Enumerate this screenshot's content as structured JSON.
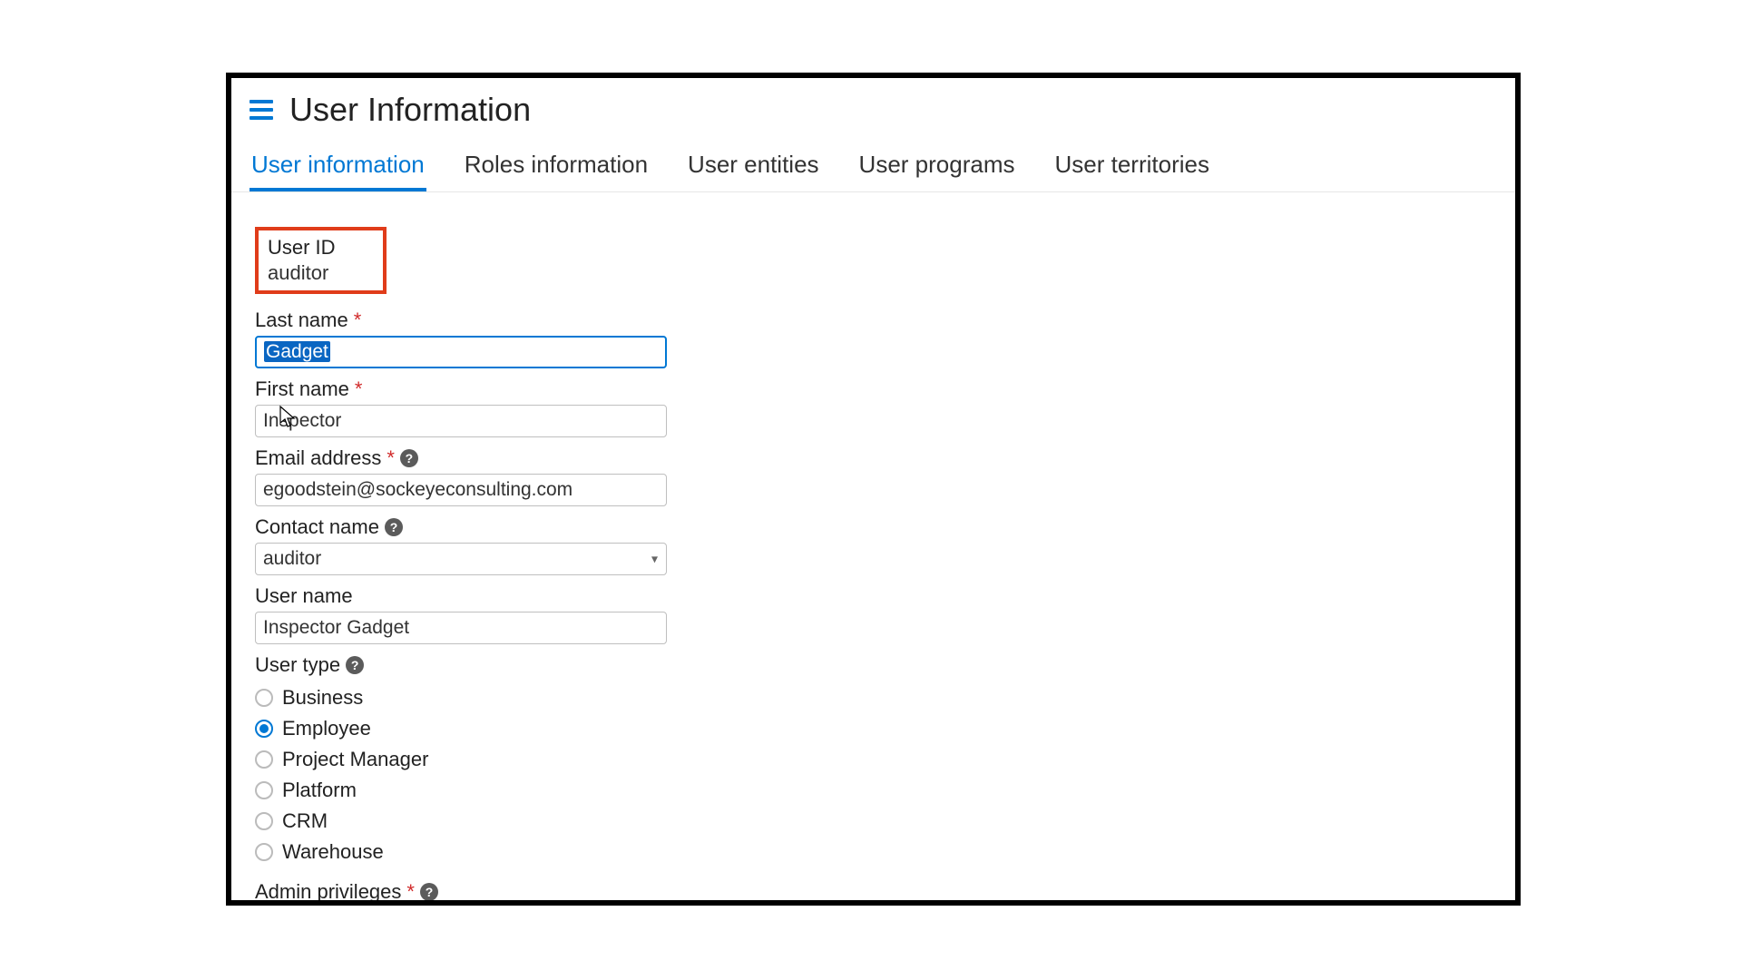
{
  "header": {
    "title": "User Information"
  },
  "tabs": [
    {
      "label": "User information",
      "active": true
    },
    {
      "label": "Roles information",
      "active": false
    },
    {
      "label": "User entities",
      "active": false
    },
    {
      "label": "User programs",
      "active": false
    },
    {
      "label": "User territories",
      "active": false
    }
  ],
  "form": {
    "user_id": {
      "label": "User ID",
      "value": "auditor"
    },
    "last_name": {
      "label": "Last name",
      "value": "Gadget",
      "required": true,
      "selected": true
    },
    "first_name": {
      "label": "First name",
      "value": "Inspector",
      "required": true
    },
    "email": {
      "label": "Email address",
      "value": "egoodstein@sockeyeconsulting.com",
      "required": true,
      "help": true
    },
    "contact_name": {
      "label": "Contact name",
      "value": "auditor",
      "help": true
    },
    "user_name": {
      "label": "User name",
      "value": "Inspector Gadget"
    },
    "user_type": {
      "label": "User type",
      "help": true,
      "options": [
        {
          "label": "Business",
          "checked": false
        },
        {
          "label": "Employee",
          "checked": true
        },
        {
          "label": "Project Manager",
          "checked": false
        },
        {
          "label": "Platform",
          "checked": false
        },
        {
          "label": "CRM",
          "checked": false
        },
        {
          "label": "Warehouse",
          "checked": false
        }
      ]
    },
    "admin_privileges": {
      "label": "Admin privileges",
      "required": true,
      "help": true
    }
  }
}
